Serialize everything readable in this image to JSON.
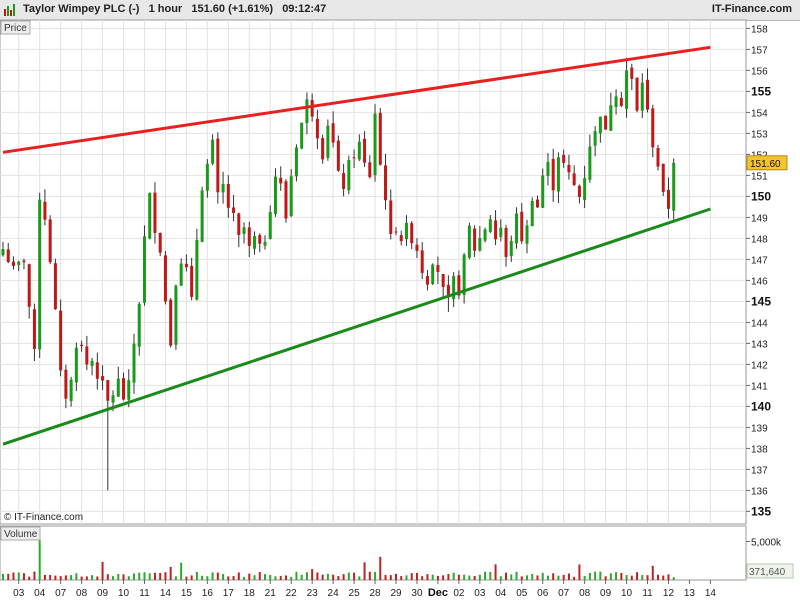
{
  "header": {
    "title": "Taylor Wimpey PLC (-)   1 hour   151.60 (+1.61%)   09:12:47",
    "brand": "IT-Finance.com"
  },
  "chart_data": {
    "type": "candlestick",
    "price_panel": {
      "label": "Price",
      "ylim": [
        134.4,
        158.4
      ],
      "ticks": [
        {
          "v": 158,
          "bold": false
        },
        {
          "v": 157,
          "bold": false
        },
        {
          "v": 156,
          "bold": false
        },
        {
          "v": 155,
          "bold": true
        },
        {
          "v": 154,
          "bold": false
        },
        {
          "v": 153,
          "bold": false
        },
        {
          "v": 152,
          "bold": false
        },
        {
          "v": 151,
          "bold": false
        },
        {
          "v": 150,
          "bold": true
        },
        {
          "v": 149,
          "bold": false
        },
        {
          "v": 148,
          "bold": false
        },
        {
          "v": 147,
          "bold": false
        },
        {
          "v": 146,
          "bold": false
        },
        {
          "v": 145,
          "bold": true
        },
        {
          "v": 144,
          "bold": false
        },
        {
          "v": 143,
          "bold": false
        },
        {
          "v": 142,
          "bold": false
        },
        {
          "v": 141,
          "bold": false
        },
        {
          "v": 140,
          "bold": true
        },
        {
          "v": 139,
          "bold": false
        },
        {
          "v": 138,
          "bold": false
        },
        {
          "v": 137,
          "bold": false
        },
        {
          "v": 136,
          "bold": false
        },
        {
          "v": 135,
          "bold": true
        }
      ],
      "last_price": "151.60",
      "last_value": 151.6,
      "watermark": "© IT-Finance.com",
      "trendlines": [
        {
          "name": "resistance",
          "color": "#e82020",
          "from": [
            0,
            152.1
          ],
          "to": [
            135,
            157.1
          ]
        },
        {
          "name": "support",
          "color": "#1a8a1a",
          "from": [
            0,
            138.2
          ],
          "to": [
            135,
            149.4
          ]
        }
      ],
      "close_path": [
        [
          0,
          147.5
        ],
        [
          2,
          146.5
        ],
        [
          4,
          147.0
        ],
        [
          6,
          142.5
        ],
        [
          7,
          150.0
        ],
        [
          8,
          149.0
        ],
        [
          9,
          147.0
        ],
        [
          10,
          144.5
        ],
        [
          11,
          141.5
        ],
        [
          12,
          140.5
        ],
        [
          13,
          141.2
        ],
        [
          14,
          143.0
        ],
        [
          15,
          142.8
        ],
        [
          16,
          142.0
        ],
        [
          17,
          142.2
        ],
        [
          18,
          141.5
        ],
        [
          19,
          141.0
        ],
        [
          20,
          140.2
        ],
        [
          21,
          140.6
        ],
        [
          22,
          141.2
        ],
        [
          23,
          140.4
        ],
        [
          24,
          141.0
        ],
        [
          25,
          143.0
        ],
        [
          26,
          145.0
        ],
        [
          27,
          148.0
        ],
        [
          28,
          150.0
        ],
        [
          29,
          148.5
        ],
        [
          30,
          147.5
        ],
        [
          31,
          145.0
        ],
        [
          32,
          143.0
        ],
        [
          33,
          146.0
        ],
        [
          34,
          147.0
        ],
        [
          35,
          146.5
        ],
        [
          36,
          145.0
        ],
        [
          37,
          148.0
        ],
        [
          38,
          150.5
        ],
        [
          39,
          151.5
        ],
        [
          40,
          152.5
        ],
        [
          41,
          150.0
        ],
        [
          42,
          150.5
        ],
        [
          43,
          149.5
        ],
        [
          44,
          149.0
        ],
        [
          45,
          148.0
        ],
        [
          46,
          148.5
        ],
        [
          47,
          147.5
        ],
        [
          48,
          148.0
        ],
        [
          49,
          147.5
        ],
        [
          50,
          148.0
        ],
        [
          51,
          149.5
        ],
        [
          52,
          151.0
        ],
        [
          53,
          150.5
        ],
        [
          54,
          149.0
        ],
        [
          55,
          151.0
        ],
        [
          56,
          152.5
        ],
        [
          57,
          153.5
        ],
        [
          58,
          154.5
        ],
        [
          59,
          154.0
        ],
        [
          60,
          153.0
        ],
        [
          61,
          152.0
        ],
        [
          62,
          153.5
        ],
        [
          63,
          152.5
        ],
        [
          64,
          151.0
        ],
        [
          65,
          150.5
        ],
        [
          66,
          151.5
        ],
        [
          67,
          152.0
        ],
        [
          68,
          152.5
        ],
        [
          69,
          151.5
        ],
        [
          70,
          151.0
        ],
        [
          71,
          154.0
        ],
        [
          72,
          151.5
        ],
        [
          73,
          150.0
        ],
        [
          74,
          148.0
        ],
        [
          75,
          148.5
        ],
        [
          76,
          148.0
        ],
        [
          77,
          148.5
        ],
        [
          78,
          148.0
        ],
        [
          79,
          147.5
        ],
        [
          80,
          146.5
        ],
        [
          81,
          146.0
        ],
        [
          82,
          147.0
        ],
        [
          83,
          146.5
        ],
        [
          84,
          145.5
        ],
        [
          85,
          145.0
        ],
        [
          86,
          146.0
        ],
        [
          87,
          145.5
        ],
        [
          88,
          147.0
        ],
        [
          89,
          148.5
        ],
        [
          90,
          147.5
        ],
        [
          91,
          148.0
        ],
        [
          92,
          148.5
        ],
        [
          93,
          149.0
        ],
        [
          94,
          148.0
        ],
        [
          95,
          148.5
        ],
        [
          96,
          147.0
        ],
        [
          97,
          148.0
        ],
        [
          98,
          149.0
        ],
        [
          99,
          148.0
        ],
        [
          100,
          148.5
        ],
        [
          101,
          150.0
        ],
        [
          102,
          149.5
        ],
        [
          103,
          151.0
        ],
        [
          104,
          151.5
        ],
        [
          105,
          150.5
        ],
        [
          106,
          152.0
        ],
        [
          107,
          151.5
        ],
        [
          108,
          151.0
        ],
        [
          109,
          150.5
        ],
        [
          110,
          150.0
        ],
        [
          111,
          151.0
        ],
        [
          112,
          152.5
        ],
        [
          113,
          153.0
        ],
        [
          114,
          154.0
        ],
        [
          115,
          153.0
        ],
        [
          116,
          154.5
        ],
        [
          117,
          155.0
        ],
        [
          118,
          154.5
        ],
        [
          119,
          156.0
        ],
        [
          120,
          155.5
        ],
        [
          121,
          154.0
        ],
        [
          122,
          155.5
        ],
        [
          123,
          154.0
        ],
        [
          124,
          152.5
        ],
        [
          125,
          151.5
        ],
        [
          126,
          150.0
        ],
        [
          127,
          149.5
        ],
        [
          128,
          151.6
        ]
      ],
      "extreme_wicks": [
        {
          "i": 20,
          "low": 136.0
        },
        {
          "i": 59,
          "high": 154.9
        },
        {
          "i": 85,
          "low": 144.5
        },
        {
          "i": 119,
          "high": 156.6
        }
      ]
    },
    "volume_panel": {
      "label": "Volume",
      "ylim": [
        0,
        7000
      ],
      "tick_label": "5,000k",
      "tick_value": 5000,
      "last_volume": "371,640",
      "last_value": 371.64
    },
    "x_axis": {
      "tick_labels": [
        {
          "label": "03",
          "i": 3,
          "bold": false
        },
        {
          "label": "04",
          "i": 7,
          "bold": false
        },
        {
          "label": "07",
          "i": 11,
          "bold": false
        },
        {
          "label": "08",
          "i": 15,
          "bold": false
        },
        {
          "label": "09",
          "i": 19,
          "bold": false
        },
        {
          "label": "10",
          "i": 23,
          "bold": false
        },
        {
          "label": "11",
          "i": 27,
          "bold": false
        },
        {
          "label": "14",
          "i": 31,
          "bold": false
        },
        {
          "label": "15",
          "i": 35,
          "bold": false
        },
        {
          "label": "16",
          "i": 39,
          "bold": false
        },
        {
          "label": "17",
          "i": 43,
          "bold": false
        },
        {
          "label": "18",
          "i": 47,
          "bold": false
        },
        {
          "label": "21",
          "i": 51,
          "bold": false
        },
        {
          "label": "22",
          "i": 55,
          "bold": false
        },
        {
          "label": "23",
          "i": 59,
          "bold": false
        },
        {
          "label": "24",
          "i": 63,
          "bold": false
        },
        {
          "label": "25",
          "i": 67,
          "bold": false
        },
        {
          "label": "28",
          "i": 71,
          "bold": false
        },
        {
          "label": "29",
          "i": 75,
          "bold": false
        },
        {
          "label": "30",
          "i": 79,
          "bold": false
        },
        {
          "label": "Dec",
          "i": 83,
          "bold": true
        },
        {
          "label": "02",
          "i": 87,
          "bold": false
        },
        {
          "label": "03",
          "i": 91,
          "bold": false
        },
        {
          "label": "04",
          "i": 95,
          "bold": false
        },
        {
          "label": "05",
          "i": 99,
          "bold": false
        },
        {
          "label": "06",
          "i": 103,
          "bold": false
        },
        {
          "label": "07",
          "i": 107,
          "bold": false
        },
        {
          "label": "08",
          "i": 111,
          "bold": false
        },
        {
          "label": "09",
          "i": 115,
          "bold": false
        },
        {
          "label": "10",
          "i": 119,
          "bold": false
        },
        {
          "label": "11",
          "i": 123,
          "bold": false
        },
        {
          "label": "12",
          "i": 127,
          "bold": false
        },
        {
          "label": "13",
          "i": 131,
          "bold": false
        },
        {
          "label": "14",
          "i": 135,
          "bold": false
        }
      ]
    },
    "colors": {
      "up": "#1a9a1a",
      "down": "#c01818",
      "grid": "#e2e2e2",
      "panel_bg": "#ffffff",
      "pricebox_bg": "#f4c430",
      "volume_up": "#2aaa2a",
      "volume_down": "#c02020"
    }
  }
}
